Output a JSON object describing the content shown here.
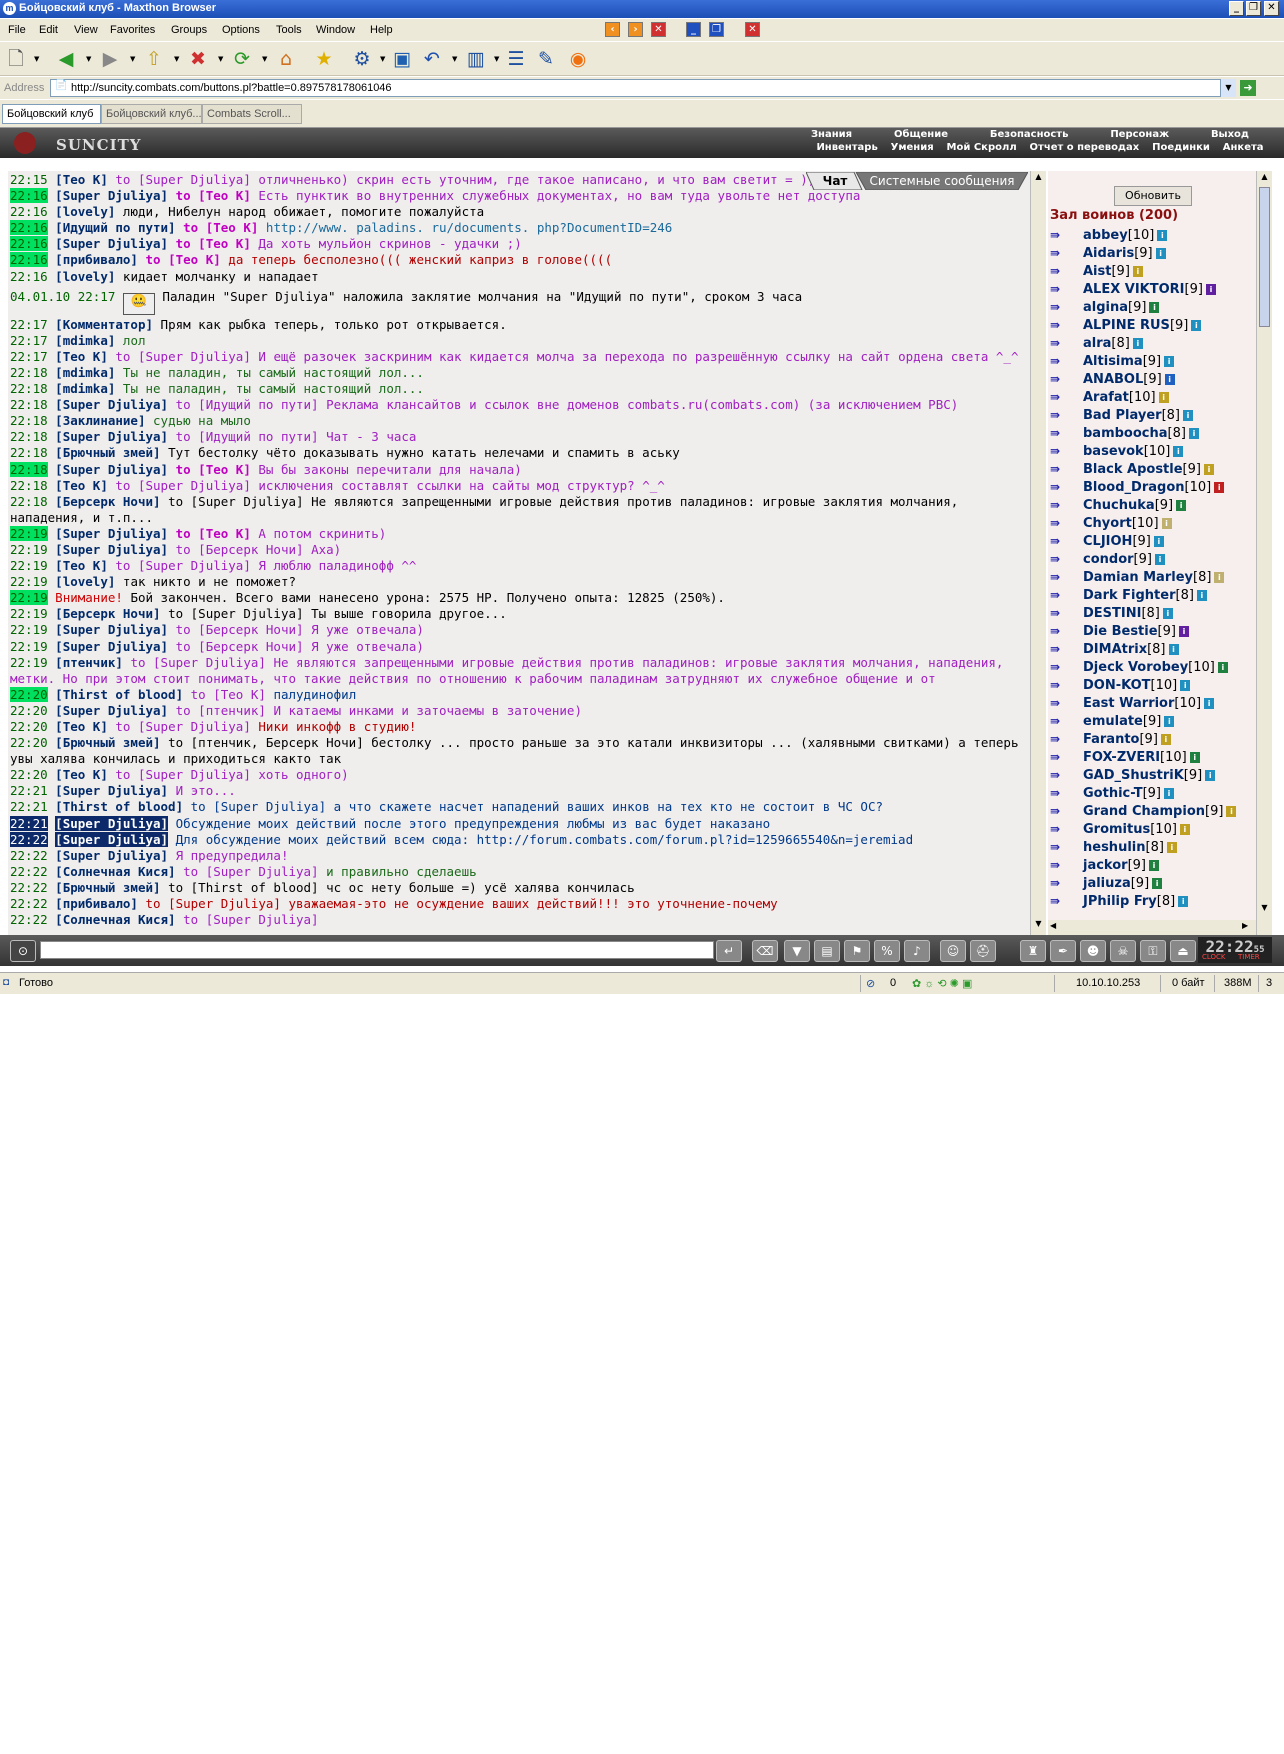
{
  "window": {
    "title": "Бойцовский клуб - Maxthon Browser"
  },
  "menu": [
    "File",
    "Edit",
    "View",
    "Favorites",
    "Groups",
    "Options",
    "Tools",
    "Window",
    "Help"
  ],
  "address": {
    "label": "Address",
    "url": "http://suncity.combats.com/buttons.pl?battle=0.897578178061046"
  },
  "tabs": [
    "Бойцовский клуб",
    "Бойцовский клуб...",
    "Combats Scroll..."
  ],
  "game": {
    "logo": "SUNCITY",
    "nav_top": [
      "Знания",
      "Общение",
      "Безопасность",
      "Персонаж",
      "Выход"
    ],
    "nav_bottom": [
      "Инвентарь",
      "Умения",
      "Мой Скролл",
      "Отчет о переводах",
      "Поединки",
      "Анкета"
    ]
  },
  "chat": {
    "tabs": [
      "Чат",
      "Системные сообщения"
    ],
    "lines": [
      {
        "ts": "22:15",
        "nick": "[Тео К]",
        "to": "to [Super Djuliya]",
        "msg": "отличненько) скрин есть уточним, где такое написано, и что вам светит = ))",
        "cls": "msgp"
      },
      {
        "ts": "22:16",
        "hl": true,
        "nick": "[Super Djuliya]",
        "nb": true,
        "to": "to [Тео К]",
        "tob": true,
        "msg": "Есть пунктик во внутренних служебных документах, но вам туда увольте нет доступа",
        "cls": "msgp"
      },
      {
        "ts": "22:16",
        "nick": "[lovely]",
        "msg": "люди, Нибелун народ обижает, помогите пожалуйста",
        "cls": "msg"
      },
      {
        "ts": "22:16",
        "hl": true,
        "nick": "[Идущий по пути]",
        "nb": true,
        "to": "to [Тео К]",
        "tob": true,
        "msg": "http://www. paladins. ru/documents. php?DocumentID=246",
        "cls": "link"
      },
      {
        "ts": "22:16",
        "hl": true,
        "nick": "[Super Djuliya]",
        "nb": true,
        "to": "to [Тео К]",
        "tob": true,
        "msg": "Да хоть мульйон скринов - удачки ;)",
        "cls": "msgp"
      },
      {
        "ts": "22:16",
        "hl": true,
        "nick": "[прибивало]",
        "nb": true,
        "to": "to [Тео К]",
        "tob": true,
        "msg": "да теперь бесполезно((( женский каприз в голове((((",
        "cls": "msgr"
      },
      {
        "ts": "22:16",
        "nick": "[lovely]",
        "msg": "кидает молчанку и нападает",
        "cls": "msg"
      },
      {
        "ts": "04.01.10 22:17",
        "sys": true,
        "msg": "Паладин \"Super Djuliya\" наложила заклятие молчания на \"Идущий по пути\", сроком 3 часа",
        "cls": "msg"
      },
      {
        "ts": "22:17",
        "nick": "[Комментатор]",
        "msg": "Прям как рыбка теперь, только рот открывается.",
        "cls": "msg"
      },
      {
        "ts": "22:17",
        "nick": "[mdimka]",
        "msg": "лол",
        "cls": "msgg"
      },
      {
        "ts": "22:17",
        "nick": "[Тео К]",
        "to": "to [Super Djuliya]",
        "msg": "И ещё разочек заскриним как кидается молча за перехода по разрешённую ссылку на сайт ордена света ^_^",
        "cls": "msgp"
      },
      {
        "ts": "22:18",
        "nick": "[mdimka]",
        "msg": "Ты не паладин, ты самый настоящий лол...",
        "cls": "msgg"
      },
      {
        "ts": "22:18",
        "nick": "[mdimka]",
        "msg": "Ты не паладин, ты самый настоящий лол...",
        "cls": "msgg"
      },
      {
        "ts": "22:18",
        "nick": "[Super Djuliya]",
        "to": "to [Идущий по пути]",
        "msg": "Реклама клансайтов и ссылок вне доменов combats.ru(combats.com) (за исключением PBC)",
        "cls": "msgp"
      },
      {
        "ts": "22:18",
        "nick": "[Заклинание]",
        "msg": "судью на мыло",
        "cls": "msgg"
      },
      {
        "ts": "22:18",
        "nick": "[Super Djuliya]",
        "to": "to [Идущий по пути]",
        "msg": "Чат - 3 часа",
        "cls": "msgp"
      },
      {
        "ts": "22:18",
        "nick": "[Брючный змей]",
        "msg": "Тут бестолку чёто доказывать нужно катать нелечами и спамить в аську",
        "cls": "msg"
      },
      {
        "ts": "22:18",
        "hl": true,
        "nick": "[Super Djuliya]",
        "nb": true,
        "to": "to [Тео К]",
        "tob": true,
        "msg": "Вы бы законы перечитали для начала)",
        "cls": "msgp"
      },
      {
        "ts": "22:18",
        "nick": "[Тео К]",
        "to": "to [Super Djuliya]",
        "msg": "исключения составлят ссылки на сайты мод структур? ^_^",
        "cls": "msgp"
      },
      {
        "ts": "22:18",
        "nick": "[Берсерк Ночи]",
        "to2": "to [Super Djuliya]",
        "msg": "Не являются запрещенными игровые действия против паладинов: игровые заклятия молчания, нападения, и т.п...",
        "cls": "msg"
      },
      {
        "ts": "22:19",
        "hl": true,
        "nick": "[Super Djuliya]",
        "nb": true,
        "to": "to [Тео К]",
        "tob": true,
        "msg": "А потом скринить)",
        "cls": "msgp"
      },
      {
        "ts": "22:19",
        "nick": "[Super Djuliya]",
        "to": "to [Берсерк Ночи]",
        "msg": "Аха)",
        "cls": "msgp"
      },
      {
        "ts": "22:19",
        "nick": "[Тео К]",
        "to": "to [Super Djuliya]",
        "msg": "Я люблю паладинофф ^^",
        "cls": "msgp"
      },
      {
        "ts": "22:19",
        "nick": "[lovely]",
        "msg": "так никто и не поможет?",
        "cls": "msg"
      },
      {
        "ts": "22:19",
        "hl": true,
        "warn": "Внимание!",
        "msg": "Бой закончен. Всего вами нанесено урона: 2575 HP. Получено опыта: 12825 (250%).",
        "cls": "msg"
      },
      {
        "ts": "22:19",
        "nick": "[Берсерк Ночи]",
        "to2": "to [Super Djuliya]",
        "msg": "Ты выше говорила другое...",
        "cls": "msg"
      },
      {
        "ts": "22:19",
        "nick": "[Super Djuliya]",
        "to": "to [Берсерк Ночи]",
        "msg": "Я уже отвечала)",
        "cls": "msgp"
      },
      {
        "ts": "22:19",
        "nick": "[Super Djuliya]",
        "to": "to [Берсерк Ночи]",
        "msg": "Я уже отвечала)",
        "cls": "msgp"
      },
      {
        "ts": "22:19",
        "nick": "[птенчик]",
        "to": "to [Super Djuliya]",
        "msg": "Не являются запрещенными игровые действия против паладинов: игровые заклятия молчания, нападения, метки. Но при этом стоит понимать, что такие действия по отношению к рабочим паладинам затрудняют их служебное общение и от",
        "cls": "msgp"
      },
      {
        "ts": "22:20",
        "hl": true,
        "nick": "[Thirst of blood]",
        "nb": true,
        "to": "to [Тео К]",
        "tobb": true,
        "msg": "палудинофил",
        "cls": "msgb"
      },
      {
        "ts": "22:20",
        "nick": "[Super Djuliya]",
        "to": "to [птенчик]",
        "msg": "И катаемы инками и заточаемы в заточение)",
        "cls": "msgp"
      },
      {
        "ts": "22:20",
        "nick": "[Тео К]",
        "to": "to [Super Djuliya]",
        "msg": "Ники инкофф в студию!",
        "cls": "msgr"
      },
      {
        "ts": "22:20",
        "nick": "[Брючный змей]",
        "to2": "to [птенчик, Берсерк Ночи]",
        "msg": "бестолку ... просто раньше за это катали инквизиторы ... (халявными свитками) а теперь увы халява кончилась и приходиться както так",
        "cls": "msg"
      },
      {
        "ts": "22:20",
        "nick": "[Тео К]",
        "to": "to [Super Djuliya]",
        "msg": "хоть одного)",
        "cls": "msgp"
      },
      {
        "ts": "22:21",
        "nick": "[Super Djuliya]",
        "msg": "И это...",
        "cls": "msgp"
      },
      {
        "ts": "22:21",
        "nick": "[Thirst of blood]",
        "to3": "to [Super Djuliya]",
        "msg": "а что скажете насчет нападений ваших инков на тех кто не состоит в ЧС ОС?",
        "cls": "msgb"
      },
      {
        "ts": "22:21",
        "sel": true,
        "nick": "[Super Djuliya]",
        "msg": "Обсуждение моих действий после этого предупреждения любмы из вас будет наказано",
        "cls": "msgb"
      },
      {
        "ts": "22:22",
        "sel": true,
        "nick": "[Super Djuliya]",
        "msg": "Для обсуждение моих действий всем сюда: http://forum.combats.com/forum.pl?id=1259665540&n=jeremiad",
        "cls": "msgb"
      },
      {
        "ts": "22:22",
        "nick": "[Super Djuliya]",
        "msg": "Я предупредила!",
        "cls": "msgp"
      },
      {
        "ts": "22:22",
        "nick": "[Солнечная Кися]",
        "to4": "to [Super Djuliya]",
        "msg": "и правильно сделаешь",
        "cls": "msgg"
      },
      {
        "ts": "22:22",
        "nick": "[Брючный змей]",
        "to2": "to [Thirst of blood]",
        "msg": "чс ос нету больше =) усё халява кончилась",
        "cls": "msg"
      },
      {
        "ts": "22:22",
        "nick": "[прибивало]",
        "to5": "to [Super Djuliya]",
        "msg": "уважаемая-это не осуждение ваших действий!!! это уточнение-почему",
        "cls": "msgr"
      },
      {
        "ts": "22:22",
        "nick": "[Солнечная Кися]",
        "to4": "to [Super Djuliya]",
        "msg": "",
        "cls": "msgg"
      }
    ]
  },
  "panel": {
    "refresh": "Обновить",
    "hall": "Зал воинов (200)",
    "users": [
      {
        "name": "abbey",
        "lvl": "[10]",
        "c": "#2090c0"
      },
      {
        "name": "Aidaris",
        "lvl": "[9]",
        "c": "#2090c0"
      },
      {
        "name": "Aist",
        "lvl": "[9]",
        "c": "#c0a020"
      },
      {
        "name": "ALEX VIKTORI",
        "lvl": "[9]",
        "c": "#6020a0"
      },
      {
        "name": "algina",
        "lvl": "[9]",
        "c": "#208040"
      },
      {
        "name": "ALPINE RUS",
        "lvl": "[9]",
        "c": "#2090c0"
      },
      {
        "name": "alra",
        "lvl": "[8]",
        "c": "#2090c0"
      },
      {
        "name": "Altisima",
        "lvl": "[9]",
        "c": "#2090c0"
      },
      {
        "name": "ANABOL",
        "lvl": "[9]",
        "c": "#2060c0"
      },
      {
        "name": "Arafat",
        "lvl": "[10]",
        "c": "#c0a020"
      },
      {
        "name": "Bad Player",
        "lvl": "[8]",
        "c": "#2090c0"
      },
      {
        "name": "bamboocha",
        "lvl": "[8]",
        "c": "#2090c0"
      },
      {
        "name": "basevok",
        "lvl": "[10]",
        "c": "#2090c0"
      },
      {
        "name": "Black Apostle",
        "lvl": "[9]",
        "c": "#c0a020"
      },
      {
        "name": "Blood_Dragon",
        "lvl": "[10]",
        "c": "#c02020"
      },
      {
        "name": "Chuchuka",
        "lvl": "[9]",
        "c": "#208040"
      },
      {
        "name": "Chyort",
        "lvl": "[10]",
        "c": "#c0b070"
      },
      {
        "name": "CLJIOH",
        "lvl": "[9]",
        "c": "#2090c0"
      },
      {
        "name": "condor",
        "lvl": "[9]",
        "c": "#2090c0"
      },
      {
        "name": "Damian Marley",
        "lvl": "[8]",
        "c": "#c0b070"
      },
      {
        "name": "Dark Fighter",
        "lvl": "[8]",
        "c": "#2090c0"
      },
      {
        "name": "DESTINI",
        "lvl": "[8]",
        "c": "#2090c0"
      },
      {
        "name": "Die Bestie",
        "lvl": "[9]",
        "c": "#6020a0"
      },
      {
        "name": "DIMAtrix",
        "lvl": "[8]",
        "c": "#2090c0"
      },
      {
        "name": "Djeck Vorobey",
        "lvl": "[10]",
        "c": "#208040"
      },
      {
        "name": "DON-KOT",
        "lvl": "[10]",
        "c": "#2090c0"
      },
      {
        "name": "East Warrior",
        "lvl": "[10]",
        "c": "#2090c0"
      },
      {
        "name": "emulate",
        "lvl": "[9]",
        "c": "#2090c0"
      },
      {
        "name": "Faranto",
        "lvl": "[9]",
        "c": "#c0a020"
      },
      {
        "name": "FOX-ZVERI",
        "lvl": "[10]",
        "c": "#208040"
      },
      {
        "name": "GAD_ShustriK",
        "lvl": "[9]",
        "c": "#2090c0"
      },
      {
        "name": "Gothic-T",
        "lvl": "[9]",
        "c": "#2090c0"
      },
      {
        "name": "Grand Champion",
        "lvl": "[9]",
        "c": "#c0a020"
      },
      {
        "name": "Gromitus",
        "lvl": "[10]",
        "c": "#c0a020"
      },
      {
        "name": "heshulin",
        "lvl": "[8]",
        "c": "#c0a020"
      },
      {
        "name": "jackor",
        "lvl": "[9]",
        "c": "#208040"
      },
      {
        "name": "jaliuza",
        "lvl": "[9]",
        "c": "#208040"
      },
      {
        "name": "JPhilip Fry",
        "lvl": "[8]",
        "c": "#2090c0"
      }
    ]
  },
  "clock": {
    "time": "22:22",
    "sec": "55",
    "clock_label": "CLOCK",
    "timer_label": "TIMER"
  },
  "status": {
    "text": "Готово",
    "count": "0",
    "ip": "10.10.10.253",
    "bytes": "0 байт",
    "mem": "388M",
    "num": "3"
  }
}
